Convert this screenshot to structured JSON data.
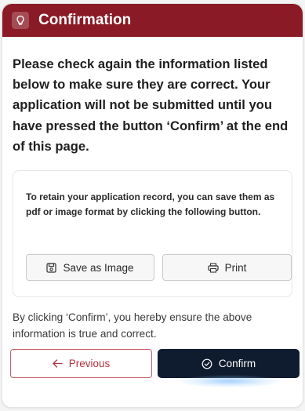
{
  "header": {
    "title": "Confirmation",
    "icon": "lightbulb-icon",
    "bg_color": "#8a1a25"
  },
  "intro": {
    "text": "Please check again the information listed below to make sure they are correct. Your application will not be submitted until you have pressed the button ‘Confirm’ at the end of this page."
  },
  "save_section": {
    "text": "To retain your application record, you can save them as pdf or image format by clicking the following button.",
    "save_image_label": "Save as Image",
    "save_image_icon": "save-icon",
    "print_label": "Print",
    "print_icon": "print-icon"
  },
  "footer": {
    "text": "By clicking ‘Confirm’, you hereby ensure the above information is true and correct.",
    "previous_label": "Previous",
    "previous_icon": "arrow-left-icon",
    "confirm_label": "Confirm",
    "confirm_icon": "check-circle-icon",
    "confirm_bg": "#0f1b2f",
    "previous_color": "#b0313e"
  }
}
